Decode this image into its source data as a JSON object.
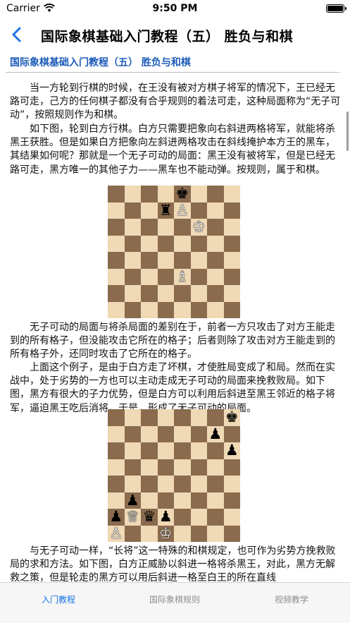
{
  "status_bar": {
    "carrier": "Carrier",
    "time": "9:50 PM"
  },
  "nav": {
    "title": "国际象棋基础入门教程（五） 胜负与和棋",
    "back_icon": "chevron-left-icon"
  },
  "article": {
    "title": "国际象棋基础入门教程（五） 胜负与和棋",
    "paragraphs": [
      "当一方轮到行棋的时候，在王没有被对方棋子将军的情况下，王已经无路可走，己方的任何棋子都没有合乎规则的着法可走，这种局面称为“无子可动”，按照规则作为和棋。",
      "如下图，轮到白方行棋。白方只需要把象向右斜进两格将军，就能将杀黑王获胜。但是如果白方把象向左斜进两格攻击在斜线掩护本方王的黑车，其结果如何呢？那就是一个无子可动的局面：黑王没有被将军，但是已经无路可走，黑方唯一的其他子力——黑车也不能动弹。按规则，属于和棋。",
      "无子可动的局面与将杀局面的差别在于，前者一方只攻击了对方王能走到的所有格子，但没能攻击它所在的格子；后者则除了攻击对方王能走到的所有格子外，还同时攻击了它所在的格子。",
      "上面这个例子，是由于白方走了坏棋，才使胜局变成了和局。然而在实战中，处于劣势的一方也可以主动走成无子可动的局面来挽救败局。如下图，黑方有很大的子力优势，但是白方可以利用后斜进至黑王邻近的格子将军，逼迫黑王吃后消将，于是，形成了无子可动的局面。",
      "与无子可动一样，“长将”这一特殊的和棋规定，也可作为劣势方挽救败局的求和方法。如下图，白方正威胁以斜进一格将杀黑王，对此，黑方无解救之策，但是轮走的黑方可以用后斜进一格至白王的所在直线"
    ]
  },
  "boards": [
    {
      "name": "diagram-1",
      "pieces": [
        {
          "sq": "e8",
          "p": "♚",
          "c": "b"
        },
        {
          "sq": "d7",
          "p": "♜",
          "c": "b"
        },
        {
          "sq": "e7",
          "p": "♙",
          "c": "w"
        },
        {
          "sq": "f6",
          "p": "♔",
          "c": "w"
        },
        {
          "sq": "e3",
          "p": "♗",
          "c": "w"
        }
      ]
    },
    {
      "name": "diagram-2",
      "pieces": [
        {
          "sq": "h8",
          "p": "♚",
          "c": "b"
        },
        {
          "sq": "g7",
          "p": "♟",
          "c": "b"
        },
        {
          "sq": "h6",
          "p": "♟",
          "c": "b"
        },
        {
          "sq": "b3",
          "p": "♟",
          "c": "b"
        },
        {
          "sq": "a2",
          "p": "♟",
          "c": "b"
        },
        {
          "sq": "b2",
          "p": "♕",
          "c": "w"
        },
        {
          "sq": "c2",
          "p": "♛",
          "c": "b"
        },
        {
          "sq": "d2",
          "p": "♟",
          "c": "b"
        },
        {
          "sq": "a1",
          "p": "♙",
          "c": "w"
        },
        {
          "sq": "d0",
          "p": "♔",
          "c": "w"
        }
      ]
    }
  ],
  "tabs": [
    {
      "label": "入门教程",
      "active": true
    },
    {
      "label": "国际象棋规则",
      "active": false
    },
    {
      "label": "视频教学",
      "active": false
    }
  ],
  "colors": {
    "accent": "#1a73e8",
    "title_blue": "#1c5bb8",
    "light_square": "#f0d9b5",
    "dark_square": "#8a6b4e"
  }
}
